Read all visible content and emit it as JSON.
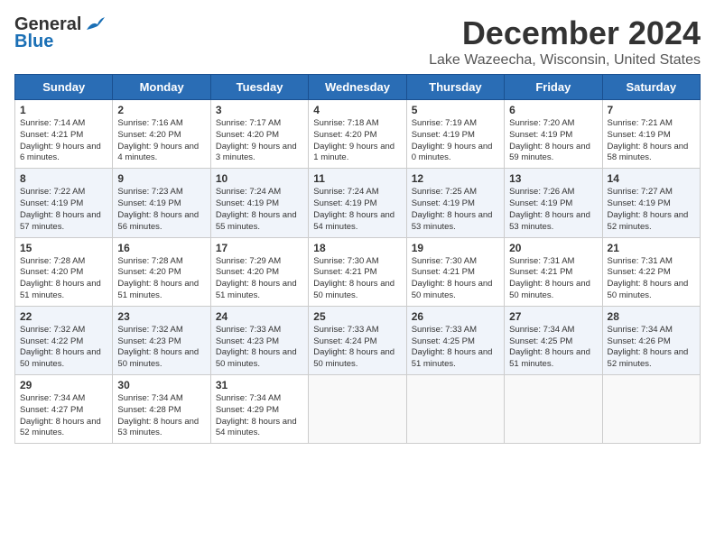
{
  "header": {
    "logo_general": "General",
    "logo_blue": "Blue",
    "month": "December 2024",
    "location": "Lake Wazeecha, Wisconsin, United States"
  },
  "weekdays": [
    "Sunday",
    "Monday",
    "Tuesday",
    "Wednesday",
    "Thursday",
    "Friday",
    "Saturday"
  ],
  "weeks": [
    [
      {
        "day": "1",
        "info": "Sunrise: 7:14 AM\nSunset: 4:21 PM\nDaylight: 9 hours and 6 minutes."
      },
      {
        "day": "2",
        "info": "Sunrise: 7:16 AM\nSunset: 4:20 PM\nDaylight: 9 hours and 4 minutes."
      },
      {
        "day": "3",
        "info": "Sunrise: 7:17 AM\nSunset: 4:20 PM\nDaylight: 9 hours and 3 minutes."
      },
      {
        "day": "4",
        "info": "Sunrise: 7:18 AM\nSunset: 4:20 PM\nDaylight: 9 hours and 1 minute."
      },
      {
        "day": "5",
        "info": "Sunrise: 7:19 AM\nSunset: 4:19 PM\nDaylight: 9 hours and 0 minutes."
      },
      {
        "day": "6",
        "info": "Sunrise: 7:20 AM\nSunset: 4:19 PM\nDaylight: 8 hours and 59 minutes."
      },
      {
        "day": "7",
        "info": "Sunrise: 7:21 AM\nSunset: 4:19 PM\nDaylight: 8 hours and 58 minutes."
      }
    ],
    [
      {
        "day": "8",
        "info": "Sunrise: 7:22 AM\nSunset: 4:19 PM\nDaylight: 8 hours and 57 minutes."
      },
      {
        "day": "9",
        "info": "Sunrise: 7:23 AM\nSunset: 4:19 PM\nDaylight: 8 hours and 56 minutes."
      },
      {
        "day": "10",
        "info": "Sunrise: 7:24 AM\nSunset: 4:19 PM\nDaylight: 8 hours and 55 minutes."
      },
      {
        "day": "11",
        "info": "Sunrise: 7:24 AM\nSunset: 4:19 PM\nDaylight: 8 hours and 54 minutes."
      },
      {
        "day": "12",
        "info": "Sunrise: 7:25 AM\nSunset: 4:19 PM\nDaylight: 8 hours and 53 minutes."
      },
      {
        "day": "13",
        "info": "Sunrise: 7:26 AM\nSunset: 4:19 PM\nDaylight: 8 hours and 53 minutes."
      },
      {
        "day": "14",
        "info": "Sunrise: 7:27 AM\nSunset: 4:19 PM\nDaylight: 8 hours and 52 minutes."
      }
    ],
    [
      {
        "day": "15",
        "info": "Sunrise: 7:28 AM\nSunset: 4:20 PM\nDaylight: 8 hours and 51 minutes."
      },
      {
        "day": "16",
        "info": "Sunrise: 7:28 AM\nSunset: 4:20 PM\nDaylight: 8 hours and 51 minutes."
      },
      {
        "day": "17",
        "info": "Sunrise: 7:29 AM\nSunset: 4:20 PM\nDaylight: 8 hours and 51 minutes."
      },
      {
        "day": "18",
        "info": "Sunrise: 7:30 AM\nSunset: 4:21 PM\nDaylight: 8 hours and 50 minutes."
      },
      {
        "day": "19",
        "info": "Sunrise: 7:30 AM\nSunset: 4:21 PM\nDaylight: 8 hours and 50 minutes."
      },
      {
        "day": "20",
        "info": "Sunrise: 7:31 AM\nSunset: 4:21 PM\nDaylight: 8 hours and 50 minutes."
      },
      {
        "day": "21",
        "info": "Sunrise: 7:31 AM\nSunset: 4:22 PM\nDaylight: 8 hours and 50 minutes."
      }
    ],
    [
      {
        "day": "22",
        "info": "Sunrise: 7:32 AM\nSunset: 4:22 PM\nDaylight: 8 hours and 50 minutes."
      },
      {
        "day": "23",
        "info": "Sunrise: 7:32 AM\nSunset: 4:23 PM\nDaylight: 8 hours and 50 minutes."
      },
      {
        "day": "24",
        "info": "Sunrise: 7:33 AM\nSunset: 4:23 PM\nDaylight: 8 hours and 50 minutes."
      },
      {
        "day": "25",
        "info": "Sunrise: 7:33 AM\nSunset: 4:24 PM\nDaylight: 8 hours and 50 minutes."
      },
      {
        "day": "26",
        "info": "Sunrise: 7:33 AM\nSunset: 4:25 PM\nDaylight: 8 hours and 51 minutes."
      },
      {
        "day": "27",
        "info": "Sunrise: 7:34 AM\nSunset: 4:25 PM\nDaylight: 8 hours and 51 minutes."
      },
      {
        "day": "28",
        "info": "Sunrise: 7:34 AM\nSunset: 4:26 PM\nDaylight: 8 hours and 52 minutes."
      }
    ],
    [
      {
        "day": "29",
        "info": "Sunrise: 7:34 AM\nSunset: 4:27 PM\nDaylight: 8 hours and 52 minutes."
      },
      {
        "day": "30",
        "info": "Sunrise: 7:34 AM\nSunset: 4:28 PM\nDaylight: 8 hours and 53 minutes."
      },
      {
        "day": "31",
        "info": "Sunrise: 7:34 AM\nSunset: 4:29 PM\nDaylight: 8 hours and 54 minutes."
      },
      null,
      null,
      null,
      null
    ]
  ]
}
